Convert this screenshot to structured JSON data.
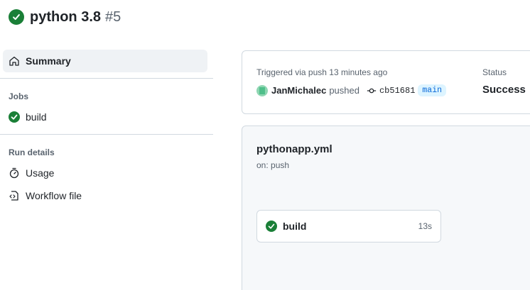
{
  "header": {
    "title": "python 3.8",
    "run_number": "#5",
    "status_icon": "check-circle-icon",
    "status_color": "#1a7f37"
  },
  "sidebar": {
    "summary_label": "Summary",
    "jobs_heading": "Jobs",
    "jobs": [
      {
        "label": "build",
        "icon": "check-circle-icon"
      }
    ],
    "run_details_heading": "Run details",
    "details": [
      {
        "label": "Usage",
        "icon": "stopwatch-icon"
      },
      {
        "label": "Workflow file",
        "icon": "file-code-icon"
      }
    ]
  },
  "trigger": {
    "label": "Triggered via push 13 minutes ago",
    "actor": "JanMichalec",
    "action": "pushed",
    "commit": "cb51681",
    "branch": "main",
    "status_label": "Status",
    "status_value": "Success"
  },
  "workflow": {
    "file": "pythonapp.yml",
    "on": "on: push",
    "job": {
      "name": "build",
      "duration": "13s"
    }
  }
}
